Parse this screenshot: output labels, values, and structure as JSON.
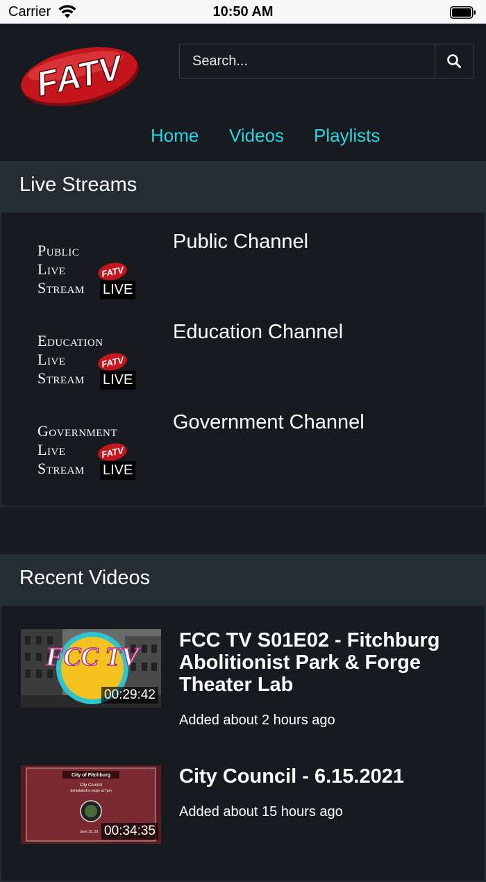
{
  "status_bar": {
    "carrier": "Carrier",
    "time": "10:50 AM"
  },
  "header": {
    "logo_text": "FATV",
    "search_placeholder": "Search...",
    "nav": [
      {
        "label": "Home"
      },
      {
        "label": "Videos"
      },
      {
        "label": "Playlists"
      }
    ]
  },
  "live_streams": {
    "title": "Live Streams",
    "items": [
      {
        "thumb_lines": [
          "Public",
          "Live",
          "Stream"
        ],
        "badge": "LIVE",
        "logo": "FATV",
        "title": "Public Channel"
      },
      {
        "thumb_lines": [
          "Education",
          "Live",
          "Stream"
        ],
        "badge": "LIVE",
        "logo": "FATV",
        "title": "Education Channel"
      },
      {
        "thumb_lines": [
          "Government",
          "Live",
          "Stream"
        ],
        "badge": "LIVE",
        "logo": "FATV",
        "title": "Government Channel"
      }
    ]
  },
  "recent_videos": {
    "title": "Recent Videos",
    "items": [
      {
        "title": "FCC TV S01E02 - Fitchburg Abolitionist Park & Forge Theater Lab",
        "duration": "00:29:42",
        "added": "Added about 2 hours ago",
        "thumb_logo": "FCC TV"
      },
      {
        "title": "City Council - 6.15.2021",
        "duration": "00:34:35",
        "added": "Added about 15 hours ago",
        "thumb_heading": "City of Fitchburg",
        "thumb_sub1": "City Council",
        "thumb_sub2": "Scheduled to begin at 7pm",
        "thumb_date": "June 15, 20"
      }
    ]
  },
  "colors": {
    "background": "#171b1f",
    "section_header": "#252d34",
    "nav_link": "#2bd4e0",
    "logo_red": "#c4161c"
  }
}
